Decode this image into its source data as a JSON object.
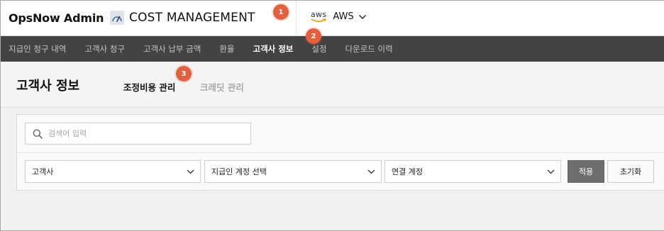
{
  "header": {
    "brand": "OpsNow Admin",
    "module_title": "COST MANAGEMENT",
    "module_icon": "gauge-icon",
    "cloud_logo_text": "aws",
    "cloud_label": "AWS",
    "cloud_dropdown_icon": "chevron-down-icon"
  },
  "badges": [
    "1",
    "2",
    "3"
  ],
  "badge_color": "#e3603f",
  "nav": {
    "items": [
      {
        "label": "지급인 청구 내역"
      },
      {
        "label": "고객사 청구"
      },
      {
        "label": "고객사 납부 금액"
      },
      {
        "label": "환율"
      },
      {
        "label": "고객사 정보",
        "active": true
      },
      {
        "label": "설정"
      },
      {
        "label": "다운로드 이력"
      }
    ],
    "background": "#434344"
  },
  "page": {
    "title": "고객사 정보",
    "subtabs": [
      {
        "label": "조정비용 관리",
        "active": true
      },
      {
        "label": "크레딧 관리",
        "active": false
      }
    ]
  },
  "filters": {
    "search_placeholder": "검색어 입력",
    "search_value": "",
    "selects": [
      {
        "label": "고객사"
      },
      {
        "label": "지급인 계정 선택"
      },
      {
        "label": "연결 계정"
      }
    ],
    "apply_label": "적용",
    "reset_label": "초기화"
  }
}
